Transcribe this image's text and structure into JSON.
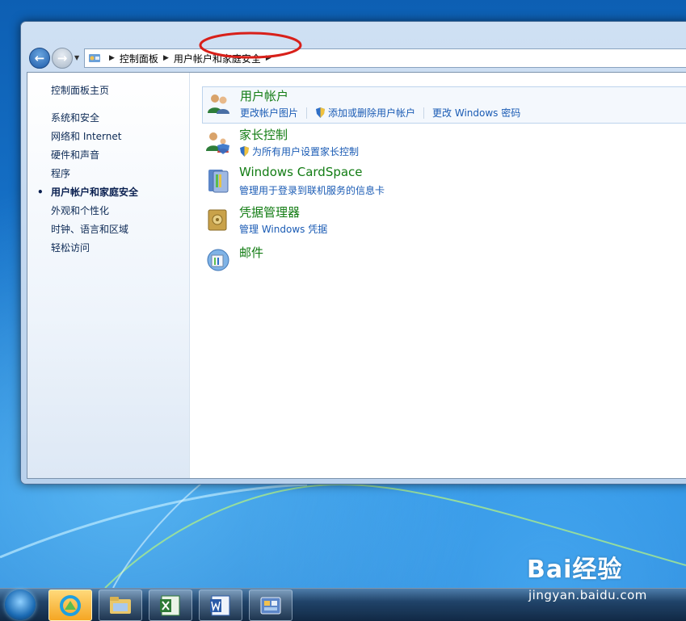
{
  "address_bar": {
    "segments": [
      "控制面板",
      "用户帐户和家庭安全"
    ]
  },
  "sidebar": {
    "home": "控制面板主页",
    "items": [
      {
        "label": "系统和安全"
      },
      {
        "label": "网络和 Internet"
      },
      {
        "label": "硬件和声音"
      },
      {
        "label": "程序"
      },
      {
        "label": "用户帐户和家庭安全",
        "active": true
      },
      {
        "label": "外观和个性化"
      },
      {
        "label": "时钟、语言和区域"
      },
      {
        "label": "轻松访问"
      }
    ]
  },
  "categories": [
    {
      "title": "用户帐户",
      "icon": "users-icon",
      "links": [
        "更改帐户图片",
        "添加或删除用户帐户",
        "更改 Windows 密码"
      ]
    },
    {
      "title": "家长控制",
      "icon": "parental-controls-icon",
      "links": [
        "为所有用户设置家长控制"
      ]
    },
    {
      "title": "Windows CardSpace",
      "icon": "cardspace-icon",
      "links": [
        "管理用于登录到联机服务的信息卡"
      ]
    },
    {
      "title": "凭据管理器",
      "icon": "credential-manager-icon",
      "links": [
        "管理 Windows 凭据"
      ]
    },
    {
      "title": "邮件",
      "icon": "mail-icon",
      "links": []
    }
  ],
  "taskbar": {
    "buttons": [
      "start-orb-icon",
      "browser-icon",
      "file-explorer-icon",
      "excel-icon",
      "word-icon",
      "control-panel-icon"
    ]
  },
  "watermark": {
    "brand": "Bai经验",
    "site": "jingyan.baidu.com"
  },
  "colors": {
    "link": "#1a5bb4",
    "category_title": "#127c13",
    "highlight_ring": "#d8201a"
  }
}
